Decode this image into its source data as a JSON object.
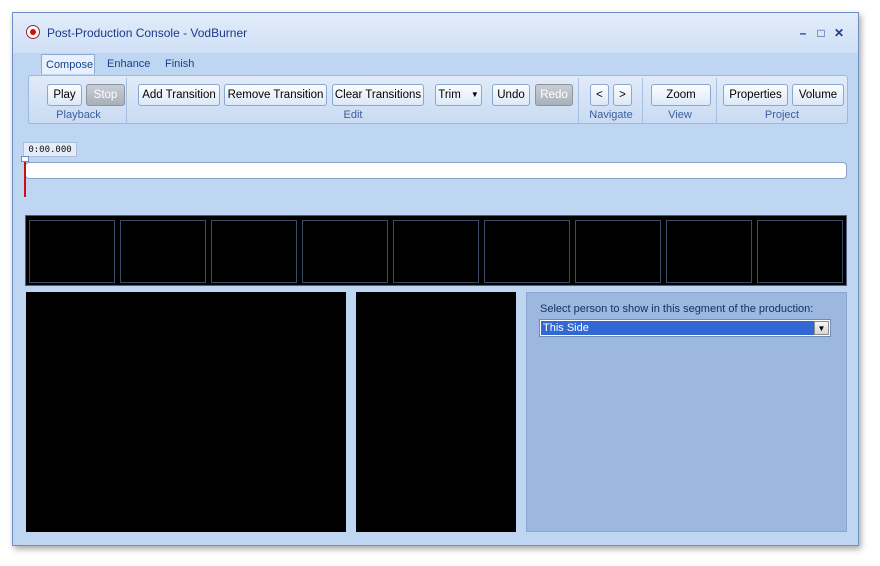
{
  "window": {
    "title": "Post-Production Console - VodBurner"
  },
  "tabs": [
    {
      "label": "Compose",
      "active": true
    },
    {
      "label": "Enhance",
      "active": false
    },
    {
      "label": "Finish",
      "active": false
    }
  ],
  "ribbon": {
    "groups": {
      "playback": "Playback",
      "edit": "Edit",
      "navigate": "Navigate",
      "view": "View",
      "project": "Project"
    },
    "buttons": {
      "play": "Play",
      "stop": "Stop",
      "add_transition": "Add Transition",
      "remove_transition": "Remove Transition",
      "clear_transitions": "Clear Transitions",
      "trim": "Trim",
      "undo": "Undo",
      "redo": "Redo",
      "prev": "<",
      "next": ">",
      "zoom": "Zoom",
      "properties": "Properties",
      "volume": "Volume"
    }
  },
  "timeline": {
    "timecode": "0:00.000"
  },
  "thumbnail_count": 9,
  "panel": {
    "label": "Select person to show in this segment of the production:",
    "selected": "This Side"
  },
  "colors": {
    "window_bg": "#bfd6f2",
    "ribbon": "#c9dbf3",
    "selection": "#3168d4",
    "playhead": "#cc1111"
  }
}
